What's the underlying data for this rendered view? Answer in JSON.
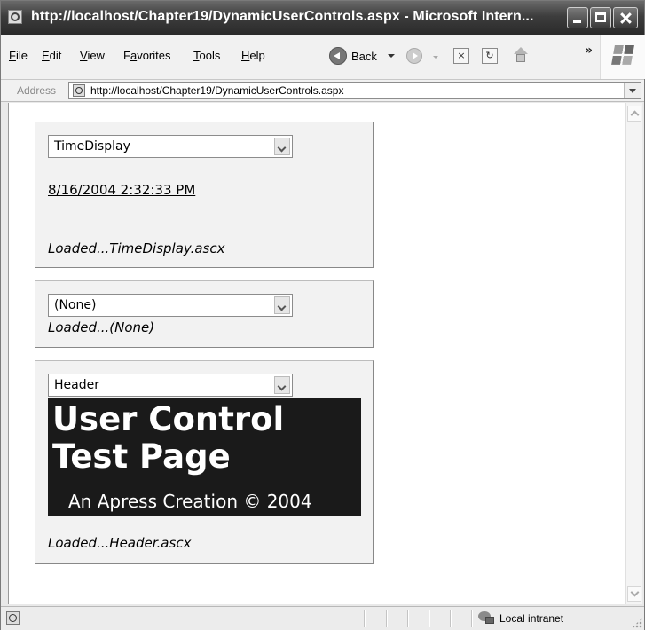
{
  "window": {
    "title": "http://localhost/Chapter19/DynamicUserControls.aspx - Microsoft Intern..."
  },
  "menubar": {
    "items": [
      {
        "label": "File",
        "underline": "F",
        "rest": "ile"
      },
      {
        "label": "Edit",
        "underline": "E",
        "rest": "dit"
      },
      {
        "label": "View",
        "underline": "V",
        "rest": "iew"
      },
      {
        "label": "Favorites",
        "pre": "F",
        "underline": "a",
        "rest": "vorites"
      },
      {
        "label": "Tools",
        "underline": "T",
        "rest": "ools"
      },
      {
        "label": "Help",
        "underline": "H",
        "rest": "elp"
      }
    ],
    "back_label": "Back",
    "overflow": "»"
  },
  "addressbar": {
    "label": "Address",
    "url": "http://localhost/Chapter19/DynamicUserControls.aspx"
  },
  "panels": [
    {
      "select_value": "TimeDisplay",
      "time_link": "8/16/2004 2:32:33 PM",
      "status": "Loaded...TimeDisplay.ascx"
    },
    {
      "select_value": "(None)",
      "status": "Loaded...(None)"
    },
    {
      "select_value": "Header",
      "banner_title": "User Control Test Page",
      "banner_subtitle": "An Apress Creation © 2004",
      "status": "Loaded...Header.ascx"
    }
  ],
  "statusbar": {
    "zone": "Local intranet"
  },
  "icons": {
    "app": "ie-page-icon",
    "back": "back-arrow-icon",
    "forward": "forward-arrow-icon",
    "stop": "stop-icon",
    "refresh": "refresh-icon",
    "home": "home-icon",
    "brand": "windows-flag-icon",
    "zone": "local-intranet-icon"
  }
}
